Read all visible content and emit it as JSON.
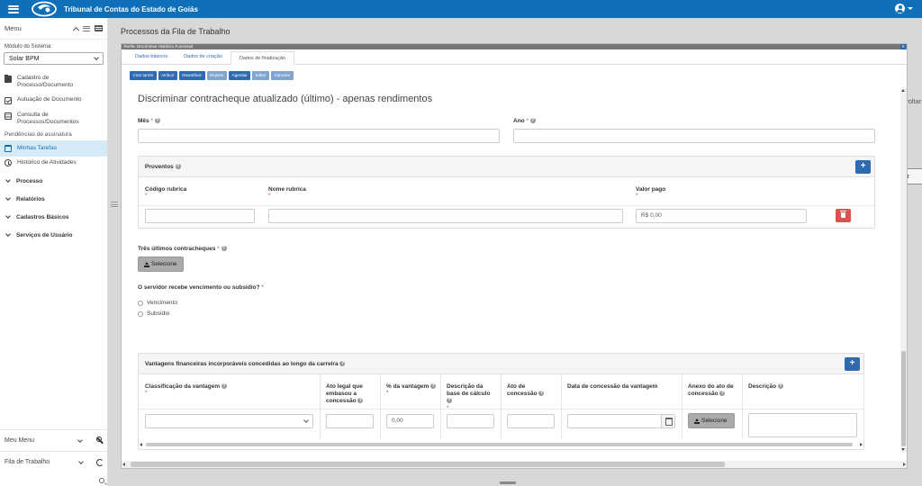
{
  "header": {
    "title": "Tribunal de Contas do Estado de Goiás",
    "logo_icon": "tce-logo-icon",
    "menu_icon": "hamburger-menu-icon",
    "user_icon": "user-circle-icon",
    "brand_color": "#0f6fb8"
  },
  "sidebar": {
    "menu_label": "Menu",
    "module_label": "Módulo do Sistema:",
    "module_value": "Solar BPM",
    "items": [
      {
        "label": "Cadastro de Processo/Documento",
        "icon": "folder-icon"
      },
      {
        "label": "Autuação de Documento",
        "icon": "check-square-icon"
      },
      {
        "label": "Consulta de Processos/Documentos",
        "icon": "document-icon"
      }
    ],
    "section_label": "Pendências de assinatura",
    "active_item": {
      "label": "Minhas Tarefas",
      "icon": "calendar-icon"
    },
    "history_item": {
      "label": "Histórico de Atividades",
      "icon": "clock-icon"
    },
    "groups": [
      "Processo",
      "Relatórios",
      "Cadastros Básicos",
      "Serviços de Usuário"
    ],
    "bottom": {
      "meu_menu": "Meu Menu",
      "fila": "Fila de Trabalho"
    }
  },
  "main": {
    "page_title": "Processos da Fila de Trabalho",
    "bg_fragment_1": "voltar",
    "bg_fragment_2": "ar"
  },
  "modal": {
    "title": "Tarefa: Discriminar Histórico Funcional",
    "close_label": "x",
    "tabs": [
      "Dados básicos",
      "Dados de criação",
      "Dados de finalização"
    ],
    "active_tab": 2,
    "actions": [
      {
        "label": "Criar tarefa",
        "enabled": true
      },
      {
        "label": "Atribuir",
        "enabled": true
      },
      {
        "label": "Desatribuir",
        "enabled": true
      },
      {
        "label": "Rejeitar",
        "enabled": false
      },
      {
        "label": "Agendar",
        "enabled": true
      },
      {
        "label": "Editar",
        "enabled": false
      },
      {
        "label": "Cancelar",
        "enabled": false
      }
    ],
    "form": {
      "title": "Discriminar contracheque atualizado (último) - apenas rendimentos",
      "mes_label": "Mês",
      "ano_label": "Ano",
      "required_mark": "*",
      "help_mark": "?",
      "proventos": {
        "title": "Proventos",
        "col_codigo": "Código rubrica",
        "col_nome": "Nome rubrica",
        "col_valor": "Valor pago",
        "valor_value": "R$ 0,00",
        "add_label": "+"
      },
      "contracheques_label": "Três últimos contracheques",
      "select_button": "Selecione",
      "question_label": "O servidor recebe vencimento ou subsídio?",
      "radio_options": [
        "Vencimento",
        "Subsídio"
      ],
      "vantagens": {
        "title": "Vantagens financeiras incorporáveis concedidas ao longo da carreira",
        "add_label": "+",
        "col_classificacao": "Classificação da vantagem",
        "col_ato_legal": "Ato legal que embasou a concessão",
        "col_percent": "% da vantagem",
        "col_descricao_base": "Descrição da base de cálculo",
        "col_ato_concessao": "Ato de concessão",
        "col_data": "Data de concessão da vantagem",
        "col_anexo": "Anexo do ato de concessão",
        "col_descricao": "Descrição",
        "percent_value": "0,00",
        "select_button": "Selecione"
      }
    }
  }
}
